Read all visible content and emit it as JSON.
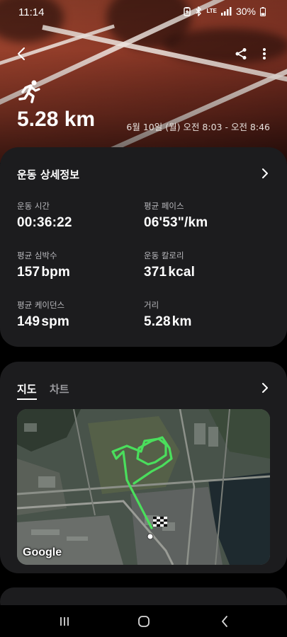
{
  "status_bar": {
    "time": "11:14",
    "network": "LTE",
    "battery": "30%"
  },
  "header": {
    "distance": "5.28 km",
    "date_range": "6월 10일 (월) 오전 8:03 - 오전 8:46"
  },
  "details": {
    "title": "운동 상세정보",
    "stats": [
      {
        "label": "운동 시간",
        "value": "00:36:22",
        "unit": ""
      },
      {
        "label": "평균 페이스",
        "value": "06'53\"/km",
        "unit": ""
      },
      {
        "label": "평균 심박수",
        "value": "157",
        "unit": "bpm"
      },
      {
        "label": "운동 칼로리",
        "value": "371",
        "unit": "kcal"
      },
      {
        "label": "평균 케이던스",
        "value": "149",
        "unit": "spm"
      },
      {
        "label": "거리",
        "value": "5.28",
        "unit": "km"
      }
    ]
  },
  "map_card": {
    "tabs": [
      "지도",
      "차트"
    ],
    "active_tab": "지도",
    "attribution": "Google"
  },
  "colors": {
    "card_bg": "#1c1c1e",
    "route": "#4ade5c"
  }
}
